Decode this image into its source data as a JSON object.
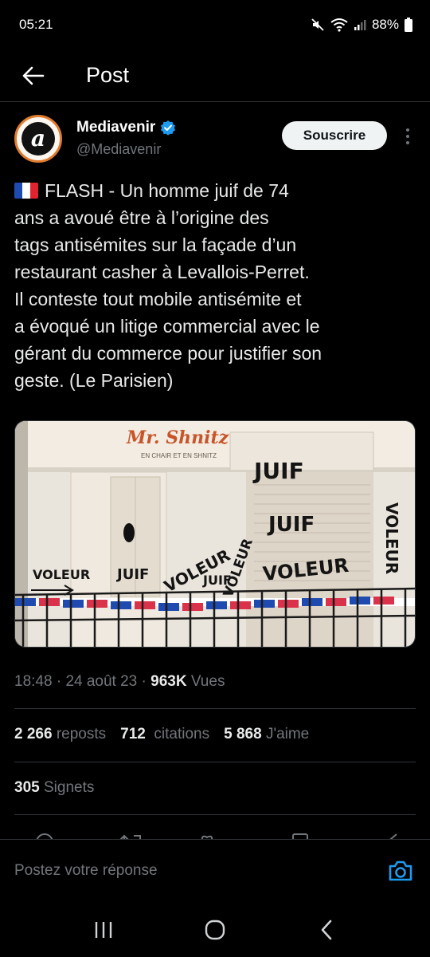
{
  "status_bar": {
    "time": "05:21",
    "battery": "88%"
  },
  "header": {
    "title": "Post"
  },
  "author": {
    "name": "Mediavenir",
    "handle": "@Mediavenir",
    "avatar_letter": "a",
    "subscribe_label": "Souscrire",
    "verified": true
  },
  "tweet": {
    "lines": [
      "FLASH - Un homme juif de 74",
      "ans a avoué être à l’origine des",
      "tags antisémites sur la façade d’un",
      "restaurant casher à Levallois-Perret.",
      "Il conteste tout mobile antisémite et",
      "a évoqué un litige commercial avec le",
      "gérant du commerce pour justifier son",
      "geste. (Le Parisien)"
    ]
  },
  "media": {
    "shop_name": "Mr. Shnitz",
    "shop_tagline": "EN CHAIR ET EN SHNITZ",
    "graffiti": [
      "JUIF",
      "VOLEUR",
      "JUIF",
      "VOLEUR",
      "JUIF",
      "VOLEUR",
      "JUIF",
      "VOLEUR",
      "VOLEUR"
    ]
  },
  "meta": {
    "time": "18:48",
    "date": "24 août 23",
    "views": "963K",
    "views_label": "Vues"
  },
  "stats": {
    "reposts": "2 266",
    "reposts_label": "reposts",
    "quotes": "712",
    "quotes_label": "citations",
    "likes": "5 868",
    "likes_label": "J'aime",
    "bookmarks": "305",
    "bookmarks_label": "Signets"
  },
  "reply": {
    "placeholder": "Postez votre réponse"
  },
  "colors": {
    "accent": "#1d9bf0",
    "background": "#000000",
    "muted": "#71767b",
    "text": "#e7e9ea"
  }
}
